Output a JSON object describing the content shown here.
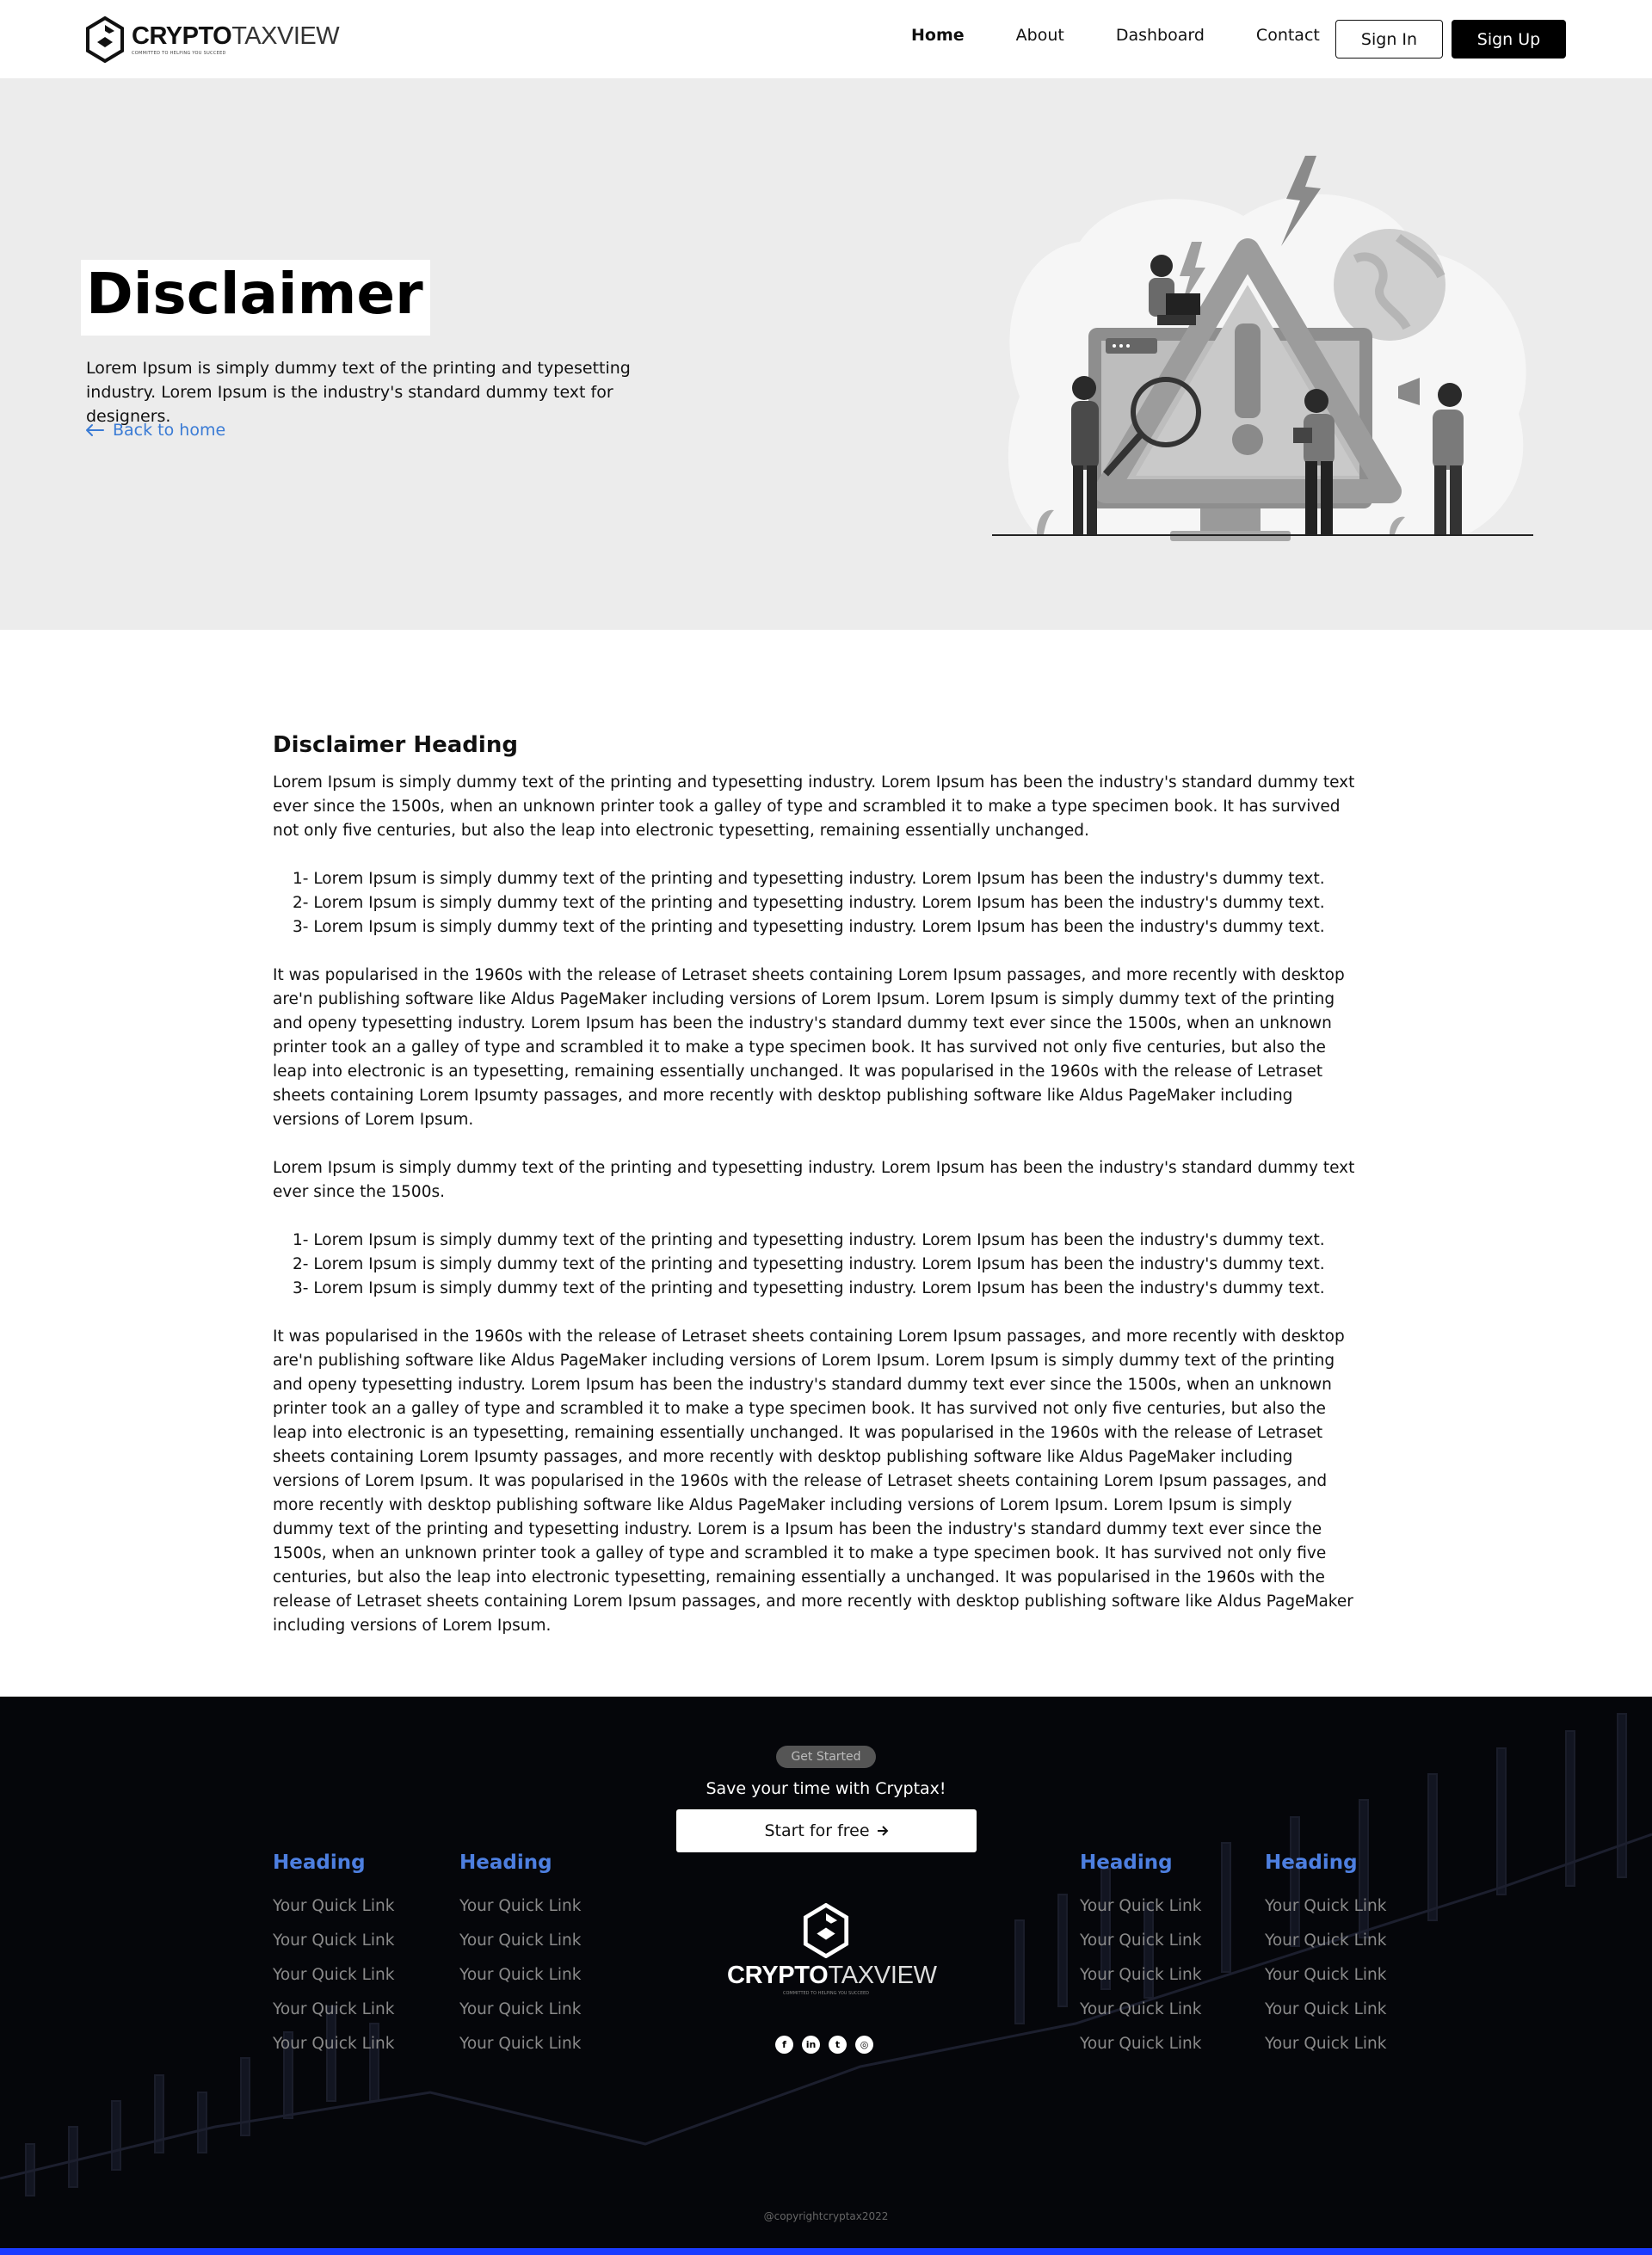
{
  "nav": {
    "logo_word_a": "CRYPTO",
    "logo_word_b": "TAXVIEW",
    "logo_tagline": "COMMITTED TO HELPING YOU SUCCEED",
    "items": [
      "Home",
      "About",
      "Dashboard",
      "Contact"
    ],
    "sign_in": "Sign In",
    "sign_up": "Sign Up"
  },
  "hero": {
    "title": "Disclaimer",
    "subtitle": "Lorem Ipsum is simply dummy text of the printing and typesetting industry. Lorem Ipsum is the industry's standard dummy text for designers.",
    "back_link": "Back to home"
  },
  "content": {
    "heading": "Disclaimer Heading",
    "p1": "Lorem Ipsum is simply dummy text of the printing and typesetting industry. Lorem Ipsum has been the industry's standard dummy text ever since the 1500s, when an unknown printer took a galley of type and scrambled it to make a type specimen book. It has survived not only five centuries, but also the leap into electronic typesetting, remaining essentially unchanged.",
    "list1": [
      "1- Lorem Ipsum is simply dummy text of the printing and typesetting industry. Lorem Ipsum has been the industry's dummy text.",
      "2- Lorem Ipsum is simply dummy text of the printing and typesetting industry. Lorem Ipsum has been the industry's dummy text.",
      "3- Lorem Ipsum is simply dummy text of the printing and typesetting industry. Lorem Ipsum has been the industry's dummy text."
    ],
    "p2": "It was popularised in the 1960s with the release of Letraset sheets containing Lorem Ipsum passages, and more recently with desktop are'n publishing software like Aldus PageMaker including versions of Lorem Ipsum. Lorem Ipsum is simply dummy text of the printing and openy typesetting industry. Lorem Ipsum has been the industry's standard dummy text ever since the 1500s, when an unknown printer took an a galley of type and scrambled it to make a type specimen book. It has survived not only five centuries, but also the leap into electronic is an typesetting, remaining essentially unchanged. It was popularised in the 1960s with the release of Letraset sheets containing Lorem Ipsumty passages, and more recently with desktop publishing software like Aldus PageMaker including versions of Lorem Ipsum.",
    "p3": "Lorem Ipsum is simply dummy text of the printing and typesetting industry. Lorem Ipsum has been the industry's standard dummy text ever since the 1500s.",
    "list2": [
      "1- Lorem Ipsum is simply dummy text of the printing and typesetting industry. Lorem Ipsum has been the industry's dummy text.",
      "2- Lorem Ipsum is simply dummy text of the printing and typesetting industry. Lorem Ipsum has been the industry's dummy text.",
      "3- Lorem Ipsum is simply dummy text of the printing and typesetting industry. Lorem Ipsum has been the industry's dummy text."
    ],
    "p4": "It was popularised in the 1960s with the release of Letraset sheets containing Lorem Ipsum passages, and more recently with desktop are'n publishing software like Aldus PageMaker including versions of Lorem Ipsum. Lorem Ipsum is simply dummy text of the printing and openy typesetting industry. Lorem Ipsum has been the industry's standard dummy text ever since the 1500s, when an unknown printer took an a galley of type and scrambled it to make a type specimen book. It has survived not only five centuries, but also the leap into electronic is an typesetting, remaining essentially unchanged. It was popularised in the 1960s with the release of Letraset sheets containing Lorem Ipsumty passages, and more recently with desktop publishing software like Aldus PageMaker including versions of Lorem Ipsum. It was popularised in the 1960s with the release of Letraset sheets containing Lorem Ipsum passages, and more recently with desktop publishing software like Aldus PageMaker including versions of Lorem Ipsum. Lorem Ipsum is simply dummy text of the printing and typesetting industry. Lorem is a Ipsum has been the industry's standard dummy text ever since the 1500s, when an unknown printer took a galley of type and scrambled it to make a type specimen book. It has survived not only five centuries, but also the leap into electronic typesetting, remaining essentially a unchanged. It was popularised in the 1960s with the release of Letraset sheets containing Lorem Ipsum passages, and more recently with desktop publishing software like Aldus PageMaker including versions of Lorem Ipsum."
  },
  "footer": {
    "pill": "Get Started",
    "tagline": "Save your time with Cryptax!",
    "cta": "Start for free",
    "columns": [
      {
        "heading": "Heading",
        "links": [
          "Your Quick Link",
          "Your Quick Link",
          "Your Quick Link",
          "Your Quick Link",
          "Your Quick Link"
        ]
      },
      {
        "heading": "Heading",
        "links": [
          "Your Quick Link",
          "Your Quick Link",
          "Your Quick Link",
          "Your Quick Link",
          "Your Quick Link"
        ]
      },
      {
        "heading": "Heading",
        "links": [
          "Your Quick Link",
          "Your Quick Link",
          "Your Quick Link",
          "Your Quick Link",
          "Your Quick Link"
        ]
      },
      {
        "heading": "Heading",
        "links": [
          "Your Quick Link",
          "Your Quick Link",
          "Your Quick Link",
          "Your Quick Link",
          "Your Quick Link"
        ]
      }
    ],
    "logo_word_a": "CRYPTO",
    "logo_word_b": "TAXVIEW",
    "logo_tagline": "COMMITTED TO HELPING YOU SUCCEED",
    "socials": [
      "facebook-icon",
      "linkedin-icon",
      "twitter-icon",
      "instagram-icon"
    ],
    "copyright": "@copyrightcryptax2022"
  },
  "colors": {
    "accent": "#3a7bd5",
    "footer_heading": "#4d7fe0",
    "footer_bg": "#05060a",
    "bottom_bar": "#1b3cff"
  }
}
